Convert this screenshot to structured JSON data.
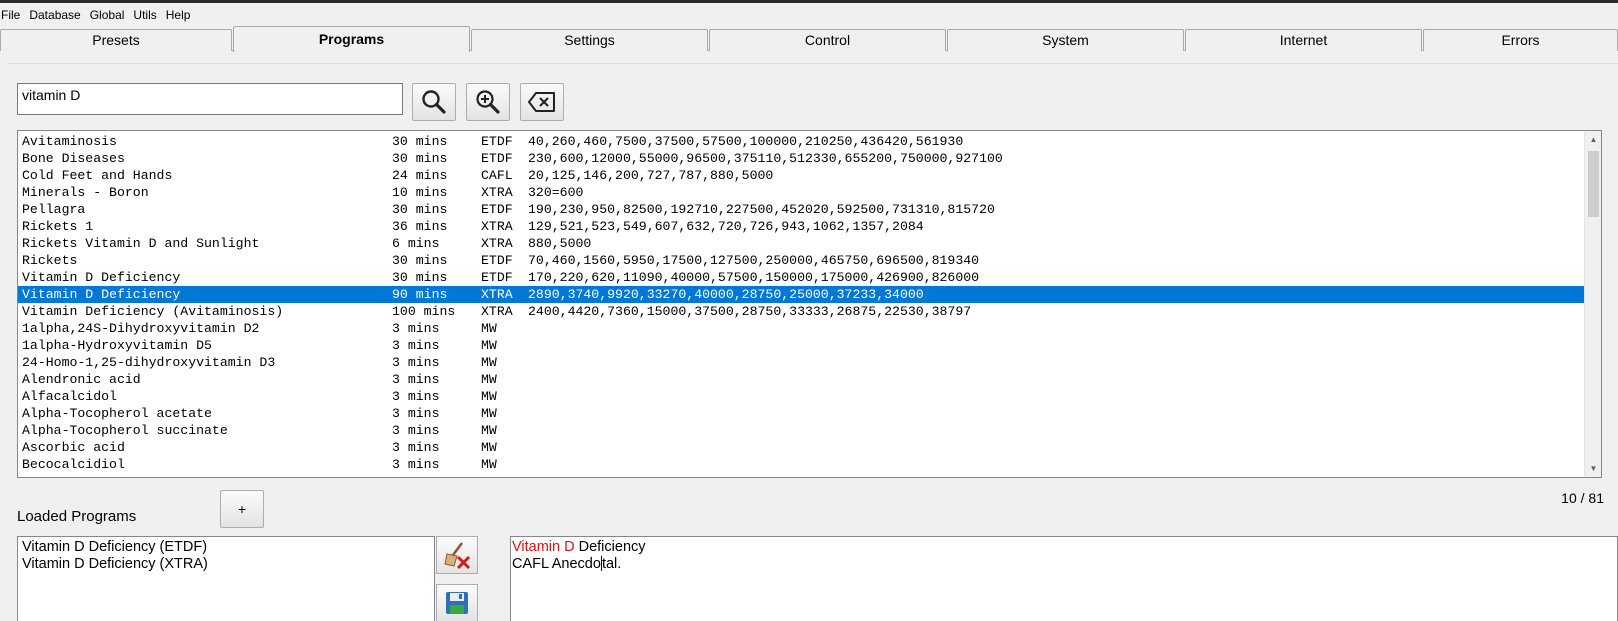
{
  "menu": [
    "File",
    "Database",
    "Global",
    "Utils",
    "Help"
  ],
  "tabs": [
    {
      "label": "Presets",
      "active": false
    },
    {
      "label": "Programs",
      "active": true
    },
    {
      "label": "Settings",
      "active": false
    },
    {
      "label": "Control",
      "active": false
    },
    {
      "label": "System",
      "active": false
    },
    {
      "label": "Internet",
      "active": false
    },
    {
      "label": "Errors",
      "active": false
    }
  ],
  "search": {
    "value": "vitamin D"
  },
  "icons": {
    "search": "search-icon",
    "zoom": "zoom-in-icon",
    "clear": "clear-icon",
    "delete": "broom-delete-icon",
    "save": "floppy-save-icon"
  },
  "programs": [
    {
      "name": "Avitaminosis",
      "duration": "30 mins",
      "type": "ETDF",
      "freqs": "40,260,460,7500,37500,57500,100000,210250,436420,561930"
    },
    {
      "name": "Bone Diseases",
      "duration": "30 mins",
      "type": "ETDF",
      "freqs": "230,600,12000,55000,96500,375110,512330,655200,750000,927100"
    },
    {
      "name": "Cold Feet and Hands",
      "duration": "24 mins",
      "type": "CAFL",
      "freqs": "20,125,146,200,727,787,880,5000"
    },
    {
      "name": "Minerals - Boron",
      "duration": "10 mins",
      "type": "XTRA",
      "freqs": "320=600"
    },
    {
      "name": "Pellagra",
      "duration": "30 mins",
      "type": "ETDF",
      "freqs": "190,230,950,82500,192710,227500,452020,592500,731310,815720"
    },
    {
      "name": "Rickets 1",
      "duration": "36 mins",
      "type": "XTRA",
      "freqs": "129,521,523,549,607,632,720,726,943,1062,1357,2084"
    },
    {
      "name": "Rickets Vitamin D and Sunlight",
      "duration": "6 mins",
      "type": "XTRA",
      "freqs": "880,5000"
    },
    {
      "name": "Rickets",
      "duration": "30 mins",
      "type": "ETDF",
      "freqs": "70,460,1560,5950,17500,127500,250000,465750,696500,819340"
    },
    {
      "name": "Vitamin D Deficiency",
      "duration": "30 mins",
      "type": "ETDF",
      "freqs": "170,220,620,11090,40000,57500,150000,175000,426900,826000"
    },
    {
      "name": "Vitamin D Deficiency",
      "duration": "90 mins",
      "type": "XTRA",
      "freqs": "2890,3740,9920,33270,40000,28750,25000,37233,34000",
      "selected": true
    },
    {
      "name": "Vitamin Deficiency (Avitaminosis)",
      "duration": "100 mins",
      "type": "XTRA",
      "freqs": "2400,4420,7360,15000,37500,28750,33333,26875,22530,38797"
    },
    {
      "name": "1alpha,24S-Dihydroxyvitamin D2",
      "duration": "3 mins",
      "type": "MW",
      "freqs": ""
    },
    {
      "name": "1alpha-Hydroxyvitamin D5",
      "duration": "3 mins",
      "type": "MW",
      "freqs": ""
    },
    {
      "name": "24-Homo-1,25-dihydroxyvitamin D3",
      "duration": "3 mins",
      "type": "MW",
      "freqs": ""
    },
    {
      "name": "Alendronic acid",
      "duration": "3 mins",
      "type": "MW",
      "freqs": ""
    },
    {
      "name": "Alfacalcidol",
      "duration": "3 mins",
      "type": "MW",
      "freqs": ""
    },
    {
      "name": "Alpha-Tocopherol acetate",
      "duration": "3 mins",
      "type": "MW",
      "freqs": ""
    },
    {
      "name": "Alpha-Tocopherol succinate",
      "duration": "3 mins",
      "type": "MW",
      "freqs": ""
    },
    {
      "name": "Ascorbic acid",
      "duration": "3 mins",
      "type": "MW",
      "freqs": ""
    },
    {
      "name": "Becocalcidiol",
      "duration": "3 mins",
      "type": "MW",
      "freqs": ""
    }
  ],
  "counter": "10 / 81",
  "loaded": {
    "label": "Loaded Programs",
    "add_label": "+",
    "items": [
      "Vitamin D Deficiency (ETDF)",
      "Vitamin D Deficiency (XTRA)"
    ]
  },
  "description": {
    "title_highlight": "Vitamin D",
    "title_rest": " Deficiency",
    "line2_before": "CAFL Anecdo",
    "line2_after": "tal."
  },
  "colors": {
    "selection": "#0078d7",
    "highlight": "#e21010"
  }
}
